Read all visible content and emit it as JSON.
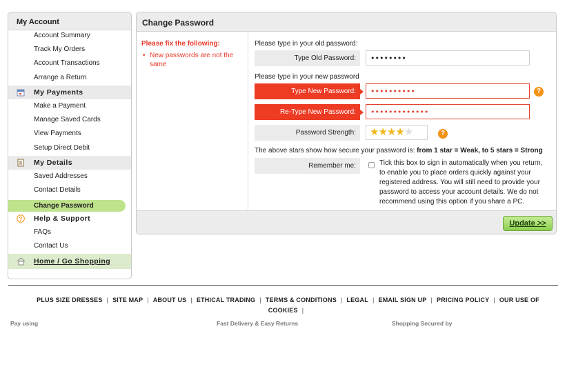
{
  "sidebar": {
    "title": "My Account",
    "account_items": [
      "Account Summary",
      "Track My Orders",
      "Account Transactions",
      "Arrange a Return"
    ],
    "payments": {
      "heading": "My Payments",
      "items": [
        "Make a Payment",
        "Manage Saved Cards",
        "View Payments",
        "Setup Direct Debit"
      ]
    },
    "details": {
      "heading": "My Details",
      "items": [
        "Saved Addresses",
        "Contact Details",
        "Change Password"
      ],
      "active": "Change Password"
    },
    "help": {
      "heading": "Help & Support",
      "items": [
        "FAQs",
        "Contact Us"
      ]
    },
    "home": "Home / Go Shopping"
  },
  "panel": {
    "title": "Change Password",
    "error": {
      "title": "Please fix the following:",
      "message": "New passwords are not the same"
    },
    "old_prompt": "Please type in your old password:",
    "old_label": "Type Old Password:",
    "old_value": "••••••••",
    "new_prompt": "Please type in your new password",
    "new_label": "Type New Password:",
    "new_value": "••••••••••",
    "retype_label": "Re-Type New Password:",
    "retype_value": "•••••••••••••",
    "strength_label": "Password Strength:",
    "strength_stars": 4,
    "strength_max": 5,
    "strength_note_prefix": "The above stars show how secure your password is: ",
    "strength_note_bold": "from 1 star = Weak, to 5 stars = Strong",
    "remember_label": "Remember me:",
    "remember_checked": false,
    "remember_text": "Tick this box to sign in automatically when you return, to enable you to place orders quickly against your registered address. You will still need to provide your password to access your account details. We do not recommend using this option if you share a PC.",
    "help_glyph": "?",
    "update_label": "Update >>"
  },
  "footer": {
    "links": [
      "PLUS SIZE DRESSES",
      "SITE MAP",
      "ABOUT US",
      "ETHICAL TRADING",
      "TERMS & CONDITIONS",
      "LEGAL",
      "EMAIL SIGN UP",
      "PRICING POLICY",
      "OUR USE OF COOKIES"
    ],
    "pay_using": "Pay using",
    "delivery": "Fast Delivery & Easy Returns",
    "secured": "Shopping Secured by"
  },
  "colors": {
    "error": "#ee3b24",
    "accent_green": "#bfe28c",
    "help_orange": "#f39214",
    "star": "#f0b81f"
  }
}
